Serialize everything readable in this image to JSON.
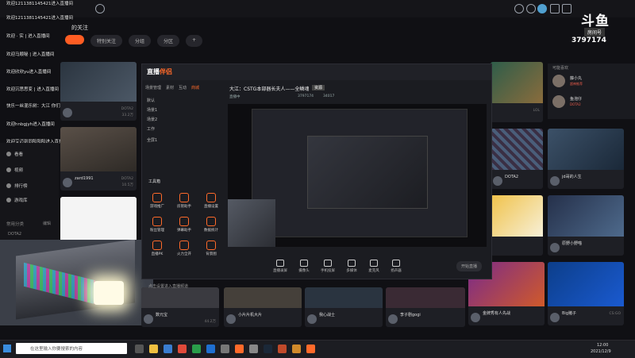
{
  "douyu_badge": {
    "logo_text": "斗鱼",
    "sub": "房间号",
    "room_id": "3797174"
  },
  "top_nav": {
    "follow_label": "的关注",
    "tabs": [
      {
        "label": "",
        "active": true
      },
      {
        "label": "特别关注",
        "active": false
      },
      {
        "label": "分组",
        "active": false
      },
      {
        "label": "分区",
        "active": false
      },
      {
        "label": "+",
        "active": false
      }
    ]
  },
  "chat": [
    "欢迎1211381145421进入直播间",
    "欢迎 · 实 | 进入直播间",
    "欢迎马顺秘 | 进入直播间",
    "欢迎欣欣yu进入直播间",
    "欢迎沉思思变 | 进入直播间",
    "快乐一丝混乐树：大江 你们老大鱼吧了吗",
    "欢迎hnbgjyh进入直播间",
    "欢迎艾迈到同阳阳阳进入直播间"
  ],
  "sidebar": {
    "items": [
      "看看",
      "视频",
      "排行榜",
      "游戏库"
    ],
    "section": "常用分类",
    "edit": "编辑",
    "tag": "DOTA2"
  },
  "cards": [
    {
      "title": "zard1991",
      "cat": "DOTA2",
      "cnt": "10.5万"
    },
    {
      "title": "DOTA2",
      "cat": "",
      "cnt": ""
    },
    {
      "title": "原野小野喵",
      "cat": "DOTA2",
      "cnt": ""
    },
    {
      "title": "jd哥的人生",
      "cat": "英雄联盟",
      "cnt": ""
    },
    {
      "title": "数元宝",
      "cat": "主机游戏",
      "cnt": "44.2万"
    },
    {
      "title": "小片片机大片",
      "cat": "",
      "cnt": ""
    },
    {
      "title": "我心战士",
      "cat": "",
      "cnt": ""
    },
    {
      "title": "李子剧gogi",
      "cat": "",
      "cnt": ""
    },
    {
      "title": "金牌秀有人先战",
      "cat": "",
      "cnt": ""
    },
    {
      "title": "Big猪子",
      "cat": "CS:GO",
      "cnt": ""
    }
  ],
  "obs": {
    "logo_a": "直播",
    "logo_b": "伴侣",
    "room_title": "大江：CSTG本部器长夫人——全鳞魂",
    "tag": "资源",
    "meta": [
      "直播中",
      "3797174",
      "34017"
    ],
    "panel_tabs": [
      "场景管理",
      "素材",
      "互动",
      "商城"
    ],
    "scenes": [
      "默认",
      "场景1",
      "场景2",
      "工作",
      "全屏1"
    ],
    "tools_label": "工具箱",
    "tools": [
      "游戏推广",
      "房管助手",
      "直播设置",
      "粉丝管理",
      "弹幕助手",
      "数据统计",
      "直播PK",
      "火力全开",
      "背景图"
    ],
    "controls": [
      "直播录屏",
      "摄像头",
      "手机投屏",
      "多媒体",
      "麦克风",
      "扬声器"
    ],
    "start_button": "开始直播",
    "bottom_text": "点击设置进入直播频道"
  },
  "right_col": {
    "title": "可能喜欢",
    "items": [
      {
        "name": "藤小丸",
        "sub": "超神推荐"
      },
      {
        "name": "鱼泡仔",
        "sub": "DOTA2"
      }
    ]
  },
  "extra_labels": [
    "10.5万",
    "33.2万",
    "DOTA2",
    "英雄联盟",
    "LOL"
  ],
  "taskbar": {
    "search_placeholder": "在这里输入你要搜索的内容",
    "time": "12:00",
    "date": "2021/12/9"
  },
  "colors": {
    "accent": "#ff5d23",
    "bg": "#101014"
  }
}
